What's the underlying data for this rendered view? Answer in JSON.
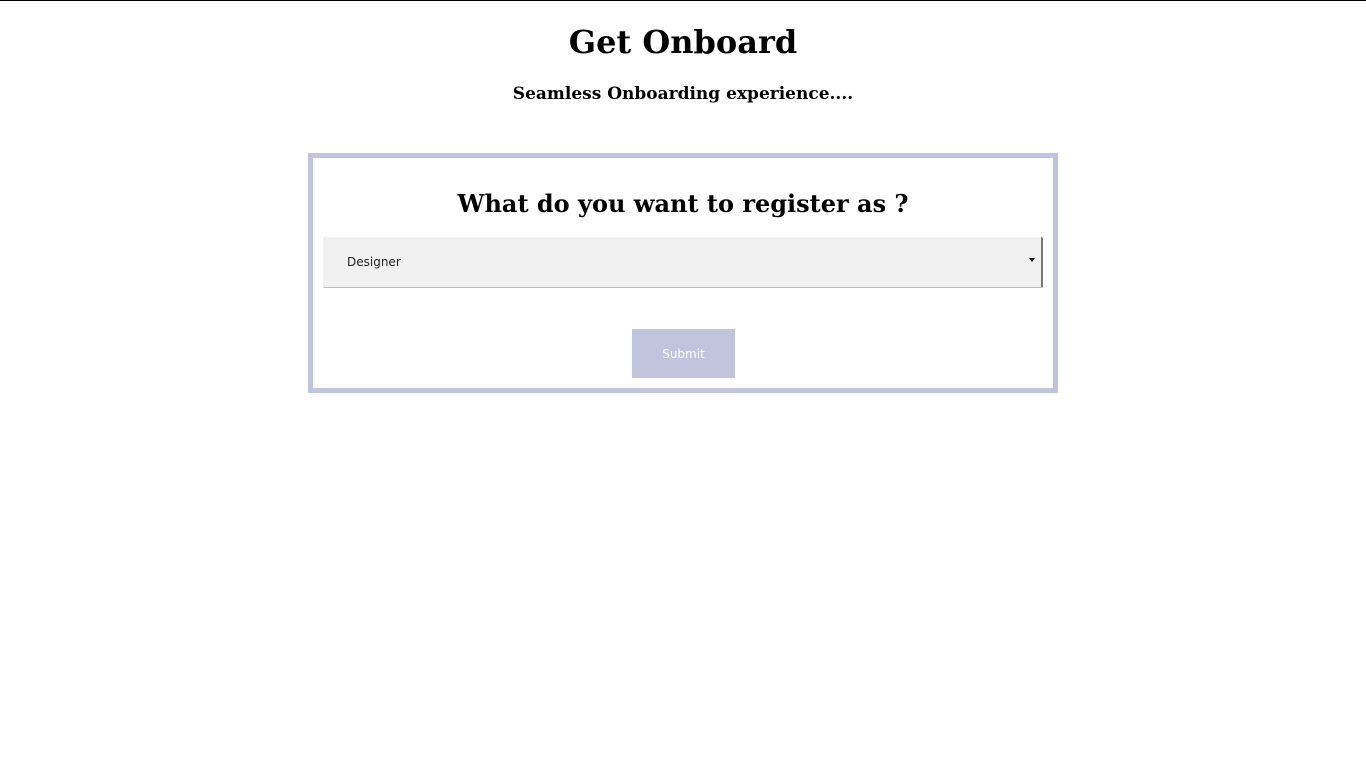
{
  "header": {
    "title": "Get Onboard",
    "subtitle": "Seamless Onboarding experience...."
  },
  "form": {
    "question": "What do you want to register as ?",
    "role_select": {
      "selected": "Designer",
      "icon": "chevron-down-icon"
    },
    "submit_label": "Submit"
  },
  "colors": {
    "accent": "#c0c4dc",
    "select_background": "#f0f0f0",
    "text": "#000000"
  }
}
